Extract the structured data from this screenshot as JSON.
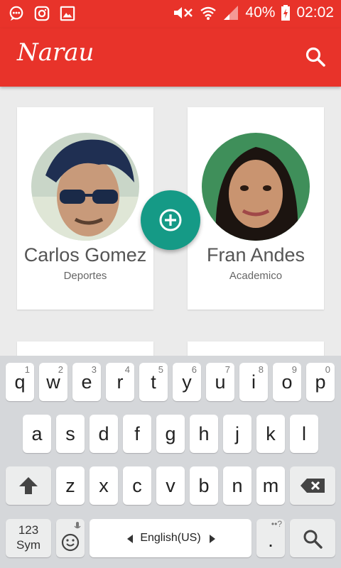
{
  "status_bar": {
    "battery": "40%",
    "time": "02:02"
  },
  "app_bar": {
    "title": "Narau"
  },
  "cards": [
    {
      "name": "Carlos Gomez",
      "category": "Deportes"
    },
    {
      "name": "Fran Andes",
      "category": "Academico"
    }
  ],
  "keyboard": {
    "row1": [
      {
        "label": "q",
        "hint": "1"
      },
      {
        "label": "w",
        "hint": "2"
      },
      {
        "label": "e",
        "hint": "3"
      },
      {
        "label": "r",
        "hint": "4"
      },
      {
        "label": "t",
        "hint": "5"
      },
      {
        "label": "y",
        "hint": "6"
      },
      {
        "label": "u",
        "hint": "7"
      },
      {
        "label": "i",
        "hint": "8"
      },
      {
        "label": "o",
        "hint": "9"
      },
      {
        "label": "p",
        "hint": "0"
      }
    ],
    "row2": [
      "a",
      "s",
      "d",
      "f",
      "g",
      "h",
      "j",
      "k",
      "l"
    ],
    "row3": [
      "z",
      "x",
      "c",
      "v",
      "b",
      "n",
      "m"
    ],
    "sym_key_top": "123",
    "sym_key_bottom": "Sym",
    "language": "English(US)",
    "period": "."
  },
  "colors": {
    "primary": "#e8332a",
    "fab": "#159a86",
    "keyboard_bg": "#d5d7da"
  }
}
